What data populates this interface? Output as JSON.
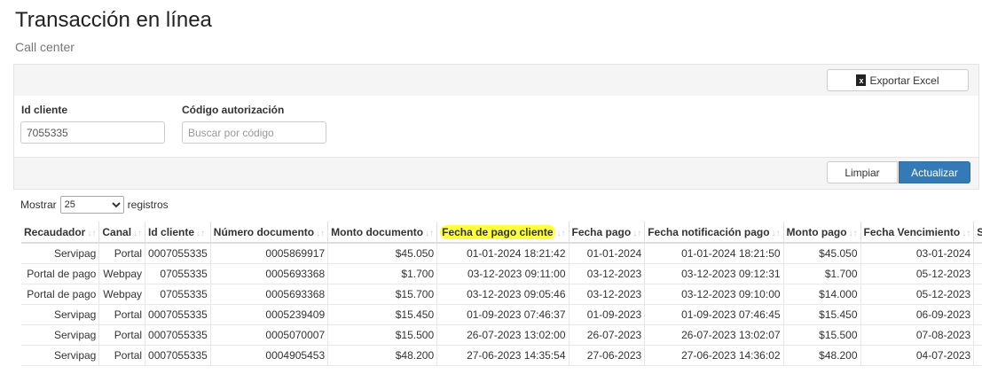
{
  "page": {
    "title": "Transacción en línea",
    "subtitle": "Call center"
  },
  "toolbar": {
    "export_label": "Exportar Excel",
    "export_icon": "excel-icon",
    "export_icon_glyph": "x"
  },
  "filters": {
    "id_cliente": {
      "label": "Id cliente",
      "value": "7055335"
    },
    "codigo": {
      "label": "Código autorización",
      "placeholder": "Buscar por código"
    }
  },
  "actions": {
    "clear_label": "Limpiar",
    "refresh_label": "Actualizar",
    "refresh_color": "#337ab7"
  },
  "length": {
    "prefix": "Mostrar",
    "selected": "25",
    "suffix": "registros"
  },
  "table": {
    "columns": [
      "Recaudador",
      "Canal",
      "Id cliente",
      "Número documento",
      "Monto documento",
      "Fecha de pago cliente",
      "Fecha pago",
      "Fecha notificación pago",
      "Monto pago",
      "Fecha Vencimiento",
      "S"
    ],
    "highlighted_column": "Fecha de pago cliente",
    "highlight_color": "#ffff3d",
    "rows": [
      [
        "Servipag",
        "Portal",
        "0007055335",
        "0005869917",
        "$45.050",
        "01-01-2024 18:21:42",
        "01-01-2024",
        "01-01-2024 18:21:50",
        "$45.050",
        "03-01-2024"
      ],
      [
        "Portal de pago",
        "Webpay",
        "07055335",
        "0005693368",
        "$1.700",
        "03-12-2023 09:11:00",
        "03-12-2023",
        "03-12-2023 09:12:31",
        "$1.700",
        "05-12-2023"
      ],
      [
        "Portal de pago",
        "Webpay",
        "07055335",
        "0005693368",
        "$15.700",
        "03-12-2023 09:05:46",
        "03-12-2023",
        "03-12-2023 09:10:00",
        "$14.000",
        "05-12-2023"
      ],
      [
        "Servipag",
        "Portal",
        "0007055335",
        "0005239409",
        "$15.450",
        "01-09-2023 07:46:37",
        "01-09-2023",
        "01-09-2023 07:46:45",
        "$15.450",
        "06-09-2023"
      ],
      [
        "Servipag",
        "Portal",
        "0007055335",
        "0005070007",
        "$15.500",
        "26-07-2023 13:02:00",
        "26-07-2023",
        "26-07-2023 13:02:07",
        "$15.500",
        "07-08-2023"
      ],
      [
        "Servipag",
        "Portal",
        "0007055335",
        "0004905453",
        "$48.200",
        "27-06-2023 14:35:54",
        "27-06-2023",
        "27-06-2023 14:36:02",
        "$48.200",
        "04-07-2023"
      ]
    ]
  }
}
